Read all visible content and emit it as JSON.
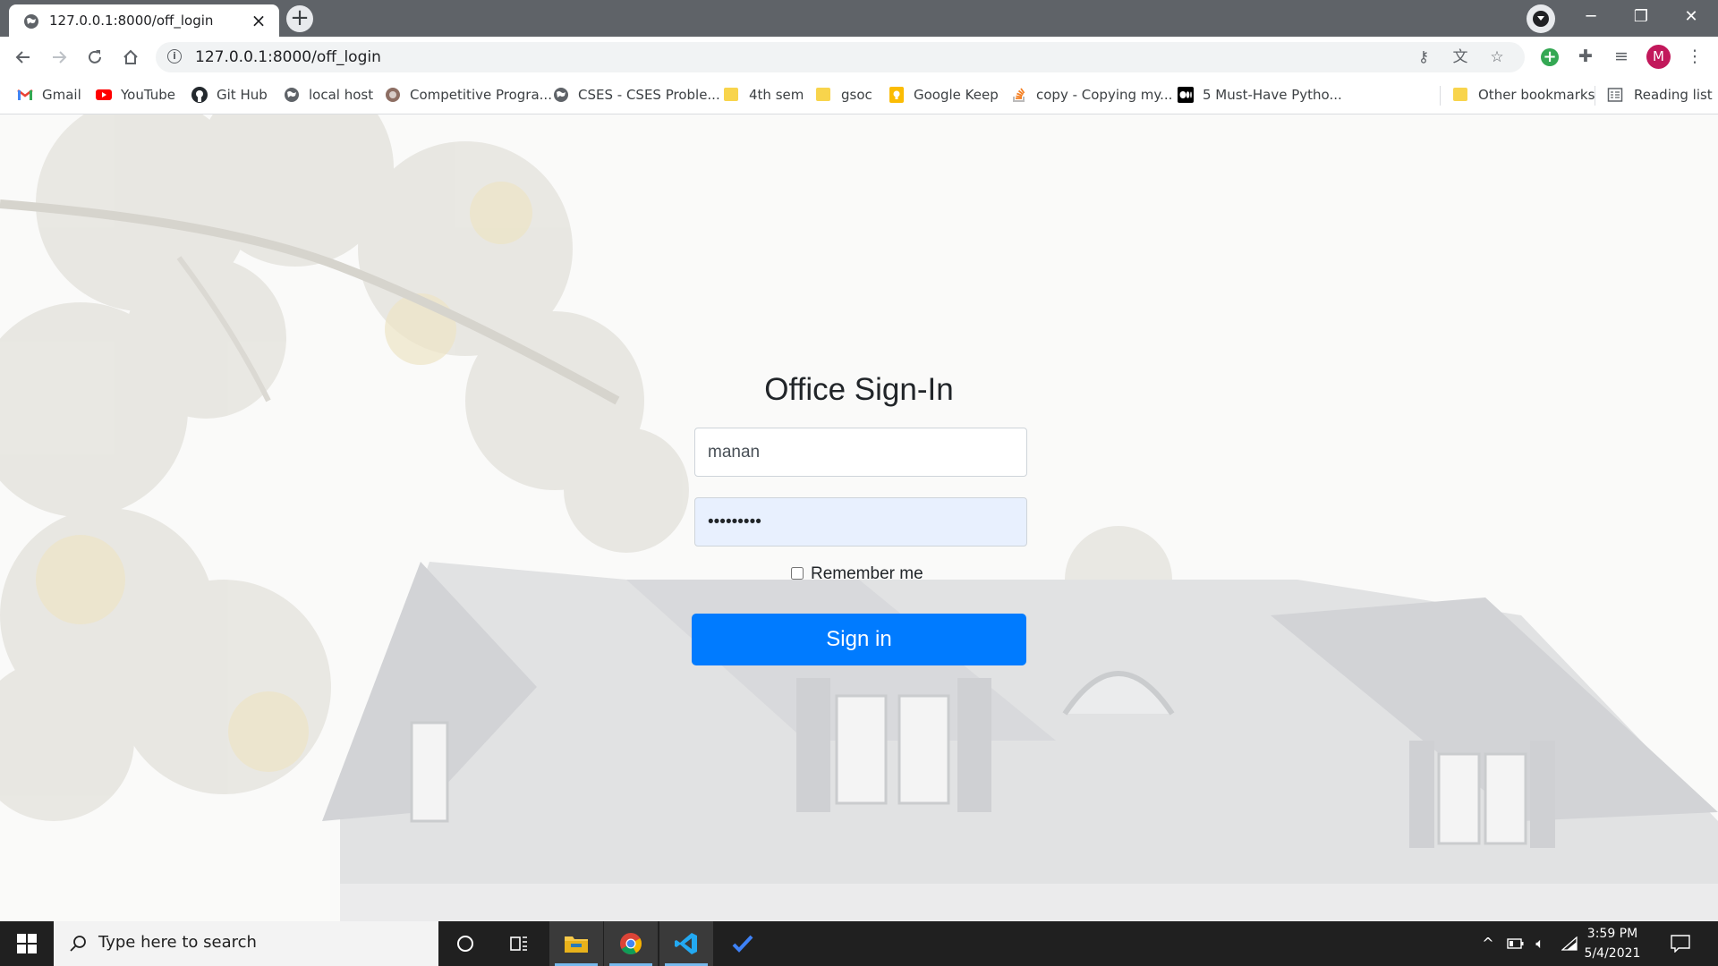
{
  "browser": {
    "tab_title": "127.0.0.1:8000/off_login",
    "url": "127.0.0.1:8000/off_login",
    "profile_initial": "M",
    "window_controls": {
      "minimize": "─",
      "restore": "❐",
      "close": "✕"
    }
  },
  "bookmarks": [
    {
      "label": "Gmail",
      "icon": "gmail-icon"
    },
    {
      "label": "YouTube",
      "icon": "youtube-icon"
    },
    {
      "label": "Git Hub",
      "icon": "github-icon"
    },
    {
      "label": "local host",
      "icon": "globe-icon"
    },
    {
      "label": "Competitive Progra...",
      "icon": "site-icon"
    },
    {
      "label": "CSES - CSES Proble...",
      "icon": "globe-icon"
    },
    {
      "label": "4th sem",
      "icon": "folder-icon"
    },
    {
      "label": "gsoc",
      "icon": "folder-icon"
    },
    {
      "label": "Google Keep",
      "icon": "keep-icon"
    },
    {
      "label": "copy - Copying my...",
      "icon": "stackoverflow-icon"
    },
    {
      "label": "5 Must-Have Pytho...",
      "icon": "medium-icon"
    }
  ],
  "bookmarks_right": {
    "other": "Other bookmarks",
    "reading_list": "Reading list"
  },
  "form": {
    "heading": "Office Sign-In",
    "username_value": "manan",
    "password_value": "manan1234",
    "remember_label": "Remember me",
    "submit_label": "Sign in"
  },
  "taskbar": {
    "search_placeholder": "Type here to search",
    "time": "3:59 PM",
    "date": "5/4/2021"
  },
  "colors": {
    "primary_button": "#007bff",
    "autofill_bg": "#e8f0fe",
    "tabstrip": "#5f6368",
    "taskbar": "#202020"
  }
}
